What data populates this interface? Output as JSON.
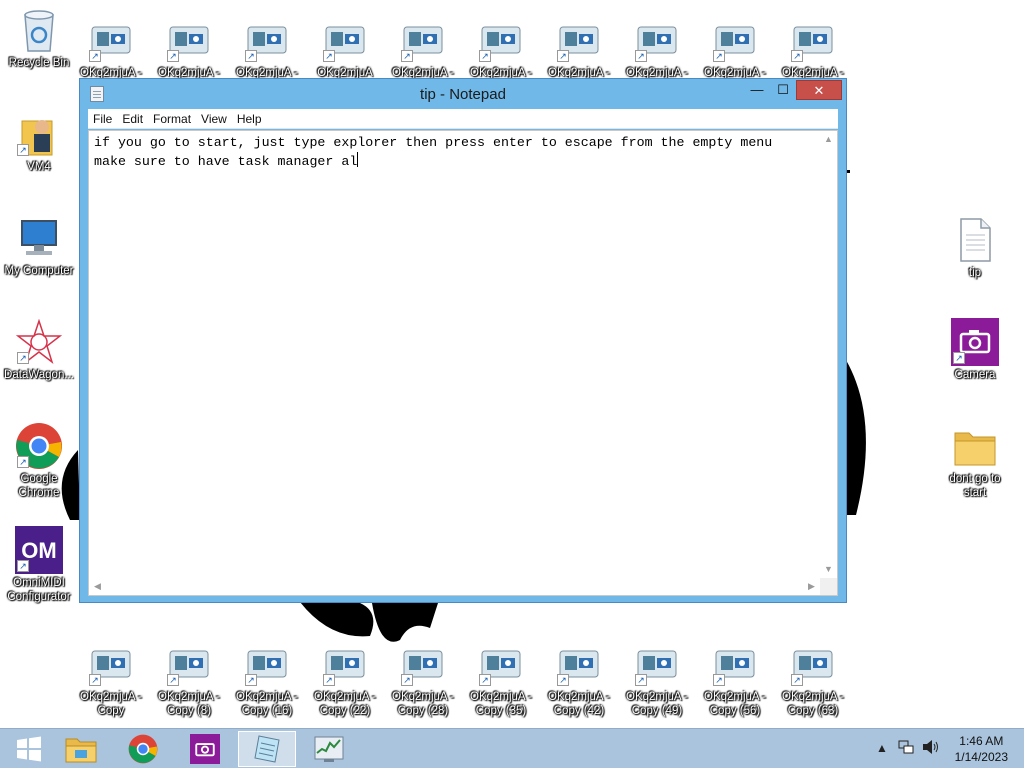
{
  "desktop": {
    "left_icons": [
      {
        "name": "recycle-bin",
        "label": "Recycle Bin",
        "icon": "recycle-bin-icon"
      },
      {
        "name": "vm4",
        "label": "VM4",
        "icon": "user-folder-icon"
      },
      {
        "name": "my-computer",
        "label": "My Computer",
        "icon": "computer-icon"
      },
      {
        "name": "datawagon",
        "label": "DataWagon...",
        "icon": "star-icon"
      },
      {
        "name": "google-chrome",
        "label": "Google",
        "label2": "Chrome",
        "icon": "chrome-icon"
      },
      {
        "name": "omnimidi",
        "label": "OmniMIDI",
        "label2": "Configurator",
        "icon": "om-icon"
      }
    ],
    "top_row": [
      {
        "label": "OKq2mjuA -"
      },
      {
        "label": "OKq2mjuA -"
      },
      {
        "label": "OKq2mjuA -"
      },
      {
        "label": "OKq2mjuA"
      },
      {
        "label": "OKq2mjuA -"
      },
      {
        "label": "OKq2mjuA -"
      },
      {
        "label": "OKq2mjuA -"
      },
      {
        "label": "OKq2mjuA -"
      },
      {
        "label": "OKq2mjuA -"
      },
      {
        "label": "OKq2mjuA -"
      }
    ],
    "bottom_row": [
      {
        "label": "OKq2mjuA -",
        "label2": "Copy"
      },
      {
        "label": "OKq2mjuA -",
        "label2": "Copy (8)"
      },
      {
        "label": "OKq2mjuA -",
        "label2": "Copy (16)"
      },
      {
        "label": "OKq2mjuA -",
        "label2": "Copy (22)"
      },
      {
        "label": "OKq2mjuA -",
        "label2": "Copy (28)"
      },
      {
        "label": "OKq2mjuA -",
        "label2": "Copy (35)"
      },
      {
        "label": "OKq2mjuA -",
        "label2": "Copy (42)"
      },
      {
        "label": "OKq2mjuA -",
        "label2": "Copy (49)"
      },
      {
        "label": "OKq2mjuA -",
        "label2": "Copy (56)"
      },
      {
        "label": "OKq2mjuA -",
        "label2": "Copy (63)"
      }
    ],
    "right_icons": [
      {
        "name": "tip-file",
        "label": "tip",
        "icon": "text-file-icon"
      },
      {
        "name": "camera",
        "label": "Camera",
        "icon": "camera-icon"
      },
      {
        "name": "dont-go-to-start",
        "label": "dont go to",
        "label2": "start",
        "icon": "folder-icon"
      }
    ]
  },
  "notepad": {
    "title": "tip - Notepad",
    "controls": {
      "minimize": "—",
      "maximize": "☐",
      "close": "✕"
    },
    "menu": [
      "File",
      "Edit",
      "Format",
      "View",
      "Help"
    ],
    "lines": [
      "if you go to start, just type explorer then press enter to escape from the empty menu",
      "make sure to have task manager al"
    ]
  },
  "taskbar": {
    "clock_time": "1:46 AM",
    "clock_date": "1/14/2023",
    "tray_up": "▲"
  },
  "colors": {
    "window_frame": "#6fb8e8",
    "taskbar": "#a9c4dc",
    "close_button": "#c7504b"
  }
}
